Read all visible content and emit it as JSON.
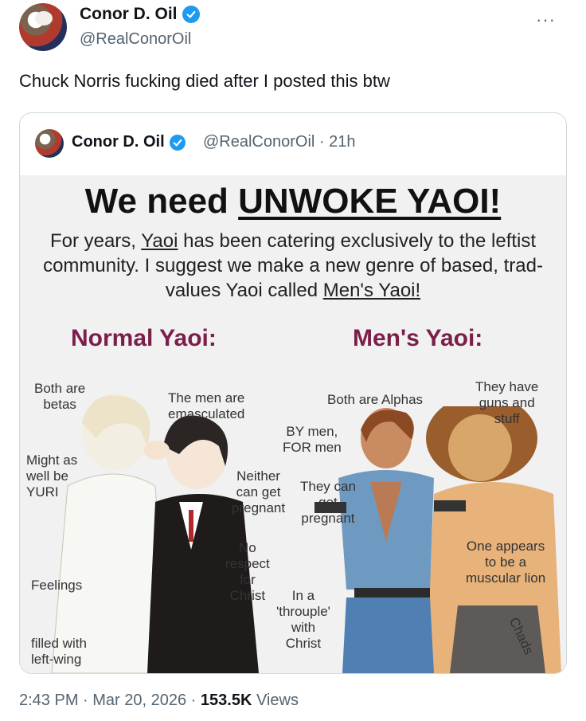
{
  "tweet": {
    "author_name": "Conor D. Oil",
    "author_handle": "@RealConorOil",
    "more_label": "···",
    "text": "Chuck Norris fucking died after I posted this btw",
    "timestamp": "2:43 PM · Mar 20, 2026 ·",
    "views_count": "153.5K",
    "views_label": "Views"
  },
  "quote": {
    "author_name": "Conor D. Oil",
    "author_handle": "@RealConorOil · 21h",
    "meme": {
      "title_prefix": "We need ",
      "title_emphasis": "UNWOKE YAOI!",
      "desc_part1": "For years, ",
      "desc_link1": "Yaoi",
      "desc_part2": " has been catering exclusively to the leftist community. I suggest we make a new genre of based, trad-values Yaoi called ",
      "desc_link2": "Men's Yaoi!",
      "left_heading": "Normal Yaoi:",
      "right_heading": "Men's Yaoi:",
      "labels": {
        "both_betas": "Both are\nbetas",
        "emasculated": "The men are\nemasculated",
        "both_alphas": "Both are Alphas",
        "guns": "They have\nguns and\nstuff",
        "by_men": "BY men,\nFOR men",
        "might_yuri": "Might as\nwell be\nYURI",
        "neither_pregnant": "Neither\ncan get\npregnant",
        "they_can_pregnant": "They can\nget\npregnant",
        "no_respect": "No\nrespect\nfor\nChrist",
        "feelings": "Feelings",
        "throuple": "In a\n'throuple'\nwith\nChrist",
        "lion": "One appears\nto be a\nmuscular lion",
        "chads": "Chads",
        "left_wing": "filled with\nleft-wing"
      }
    }
  },
  "colors": {
    "verified": "#1d9bf0",
    "heading": "#7a1f4a",
    "secondary_text": "#536471"
  }
}
